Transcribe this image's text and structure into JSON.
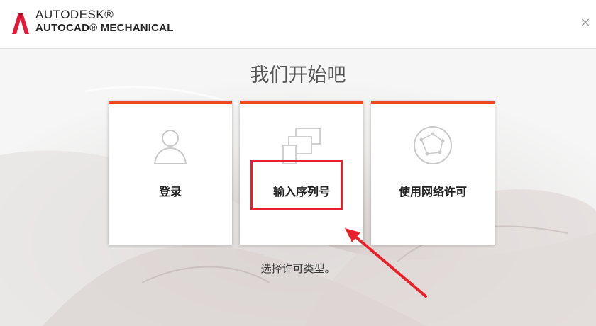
{
  "header": {
    "brand_line1": "AUTODESK®",
    "brand_line2": "AUTOCAD® MECHANICAL",
    "close_symbol": "×",
    "logo_icon": "autodesk-a-logo",
    "accent_color": "#f24a1e"
  },
  "main": {
    "title": "我们开始吧",
    "subtitle": "选择许可类型。",
    "cards": [
      {
        "label": "登录",
        "icon": "user-icon"
      },
      {
        "label": "输入序列号",
        "icon": "screens-icon"
      },
      {
        "label": "使用网络许可",
        "icon": "network-globe-icon"
      }
    ]
  },
  "annotation": {
    "highlight_color": "#e8202a"
  }
}
